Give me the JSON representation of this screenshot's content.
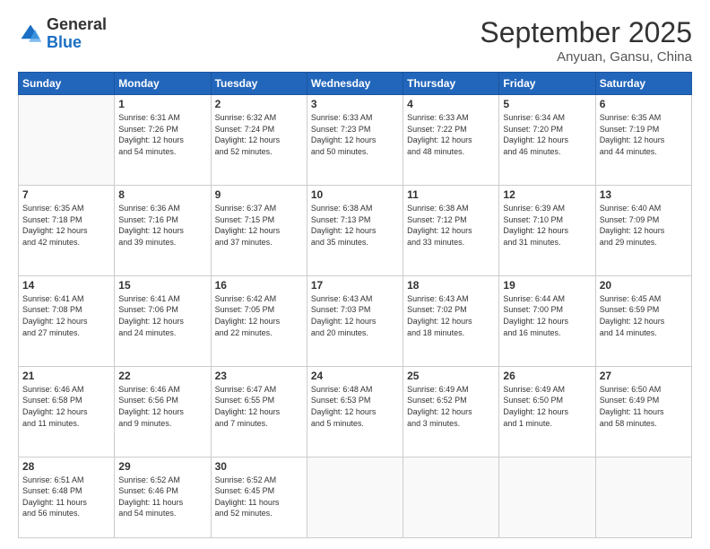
{
  "header": {
    "logo_line1": "General",
    "logo_line2": "Blue",
    "month": "September 2025",
    "location": "Anyuan, Gansu, China"
  },
  "weekdays": [
    "Sunday",
    "Monday",
    "Tuesday",
    "Wednesday",
    "Thursday",
    "Friday",
    "Saturday"
  ],
  "weeks": [
    [
      {
        "day": "",
        "info": ""
      },
      {
        "day": "1",
        "info": "Sunrise: 6:31 AM\nSunset: 7:26 PM\nDaylight: 12 hours\nand 54 minutes."
      },
      {
        "day": "2",
        "info": "Sunrise: 6:32 AM\nSunset: 7:24 PM\nDaylight: 12 hours\nand 52 minutes."
      },
      {
        "day": "3",
        "info": "Sunrise: 6:33 AM\nSunset: 7:23 PM\nDaylight: 12 hours\nand 50 minutes."
      },
      {
        "day": "4",
        "info": "Sunrise: 6:33 AM\nSunset: 7:22 PM\nDaylight: 12 hours\nand 48 minutes."
      },
      {
        "day": "5",
        "info": "Sunrise: 6:34 AM\nSunset: 7:20 PM\nDaylight: 12 hours\nand 46 minutes."
      },
      {
        "day": "6",
        "info": "Sunrise: 6:35 AM\nSunset: 7:19 PM\nDaylight: 12 hours\nand 44 minutes."
      }
    ],
    [
      {
        "day": "7",
        "info": "Sunrise: 6:35 AM\nSunset: 7:18 PM\nDaylight: 12 hours\nand 42 minutes."
      },
      {
        "day": "8",
        "info": "Sunrise: 6:36 AM\nSunset: 7:16 PM\nDaylight: 12 hours\nand 39 minutes."
      },
      {
        "day": "9",
        "info": "Sunrise: 6:37 AM\nSunset: 7:15 PM\nDaylight: 12 hours\nand 37 minutes."
      },
      {
        "day": "10",
        "info": "Sunrise: 6:38 AM\nSunset: 7:13 PM\nDaylight: 12 hours\nand 35 minutes."
      },
      {
        "day": "11",
        "info": "Sunrise: 6:38 AM\nSunset: 7:12 PM\nDaylight: 12 hours\nand 33 minutes."
      },
      {
        "day": "12",
        "info": "Sunrise: 6:39 AM\nSunset: 7:10 PM\nDaylight: 12 hours\nand 31 minutes."
      },
      {
        "day": "13",
        "info": "Sunrise: 6:40 AM\nSunset: 7:09 PM\nDaylight: 12 hours\nand 29 minutes."
      }
    ],
    [
      {
        "day": "14",
        "info": "Sunrise: 6:41 AM\nSunset: 7:08 PM\nDaylight: 12 hours\nand 27 minutes."
      },
      {
        "day": "15",
        "info": "Sunrise: 6:41 AM\nSunset: 7:06 PM\nDaylight: 12 hours\nand 24 minutes."
      },
      {
        "day": "16",
        "info": "Sunrise: 6:42 AM\nSunset: 7:05 PM\nDaylight: 12 hours\nand 22 minutes."
      },
      {
        "day": "17",
        "info": "Sunrise: 6:43 AM\nSunset: 7:03 PM\nDaylight: 12 hours\nand 20 minutes."
      },
      {
        "day": "18",
        "info": "Sunrise: 6:43 AM\nSunset: 7:02 PM\nDaylight: 12 hours\nand 18 minutes."
      },
      {
        "day": "19",
        "info": "Sunrise: 6:44 AM\nSunset: 7:00 PM\nDaylight: 12 hours\nand 16 minutes."
      },
      {
        "day": "20",
        "info": "Sunrise: 6:45 AM\nSunset: 6:59 PM\nDaylight: 12 hours\nand 14 minutes."
      }
    ],
    [
      {
        "day": "21",
        "info": "Sunrise: 6:46 AM\nSunset: 6:58 PM\nDaylight: 12 hours\nand 11 minutes."
      },
      {
        "day": "22",
        "info": "Sunrise: 6:46 AM\nSunset: 6:56 PM\nDaylight: 12 hours\nand 9 minutes."
      },
      {
        "day": "23",
        "info": "Sunrise: 6:47 AM\nSunset: 6:55 PM\nDaylight: 12 hours\nand 7 minutes."
      },
      {
        "day": "24",
        "info": "Sunrise: 6:48 AM\nSunset: 6:53 PM\nDaylight: 12 hours\nand 5 minutes."
      },
      {
        "day": "25",
        "info": "Sunrise: 6:49 AM\nSunset: 6:52 PM\nDaylight: 12 hours\nand 3 minutes."
      },
      {
        "day": "26",
        "info": "Sunrise: 6:49 AM\nSunset: 6:50 PM\nDaylight: 12 hours\nand 1 minute."
      },
      {
        "day": "27",
        "info": "Sunrise: 6:50 AM\nSunset: 6:49 PM\nDaylight: 11 hours\nand 58 minutes."
      }
    ],
    [
      {
        "day": "28",
        "info": "Sunrise: 6:51 AM\nSunset: 6:48 PM\nDaylight: 11 hours\nand 56 minutes."
      },
      {
        "day": "29",
        "info": "Sunrise: 6:52 AM\nSunset: 6:46 PM\nDaylight: 11 hours\nand 54 minutes."
      },
      {
        "day": "30",
        "info": "Sunrise: 6:52 AM\nSunset: 6:45 PM\nDaylight: 11 hours\nand 52 minutes."
      },
      {
        "day": "",
        "info": ""
      },
      {
        "day": "",
        "info": ""
      },
      {
        "day": "",
        "info": ""
      },
      {
        "day": "",
        "info": ""
      }
    ]
  ]
}
